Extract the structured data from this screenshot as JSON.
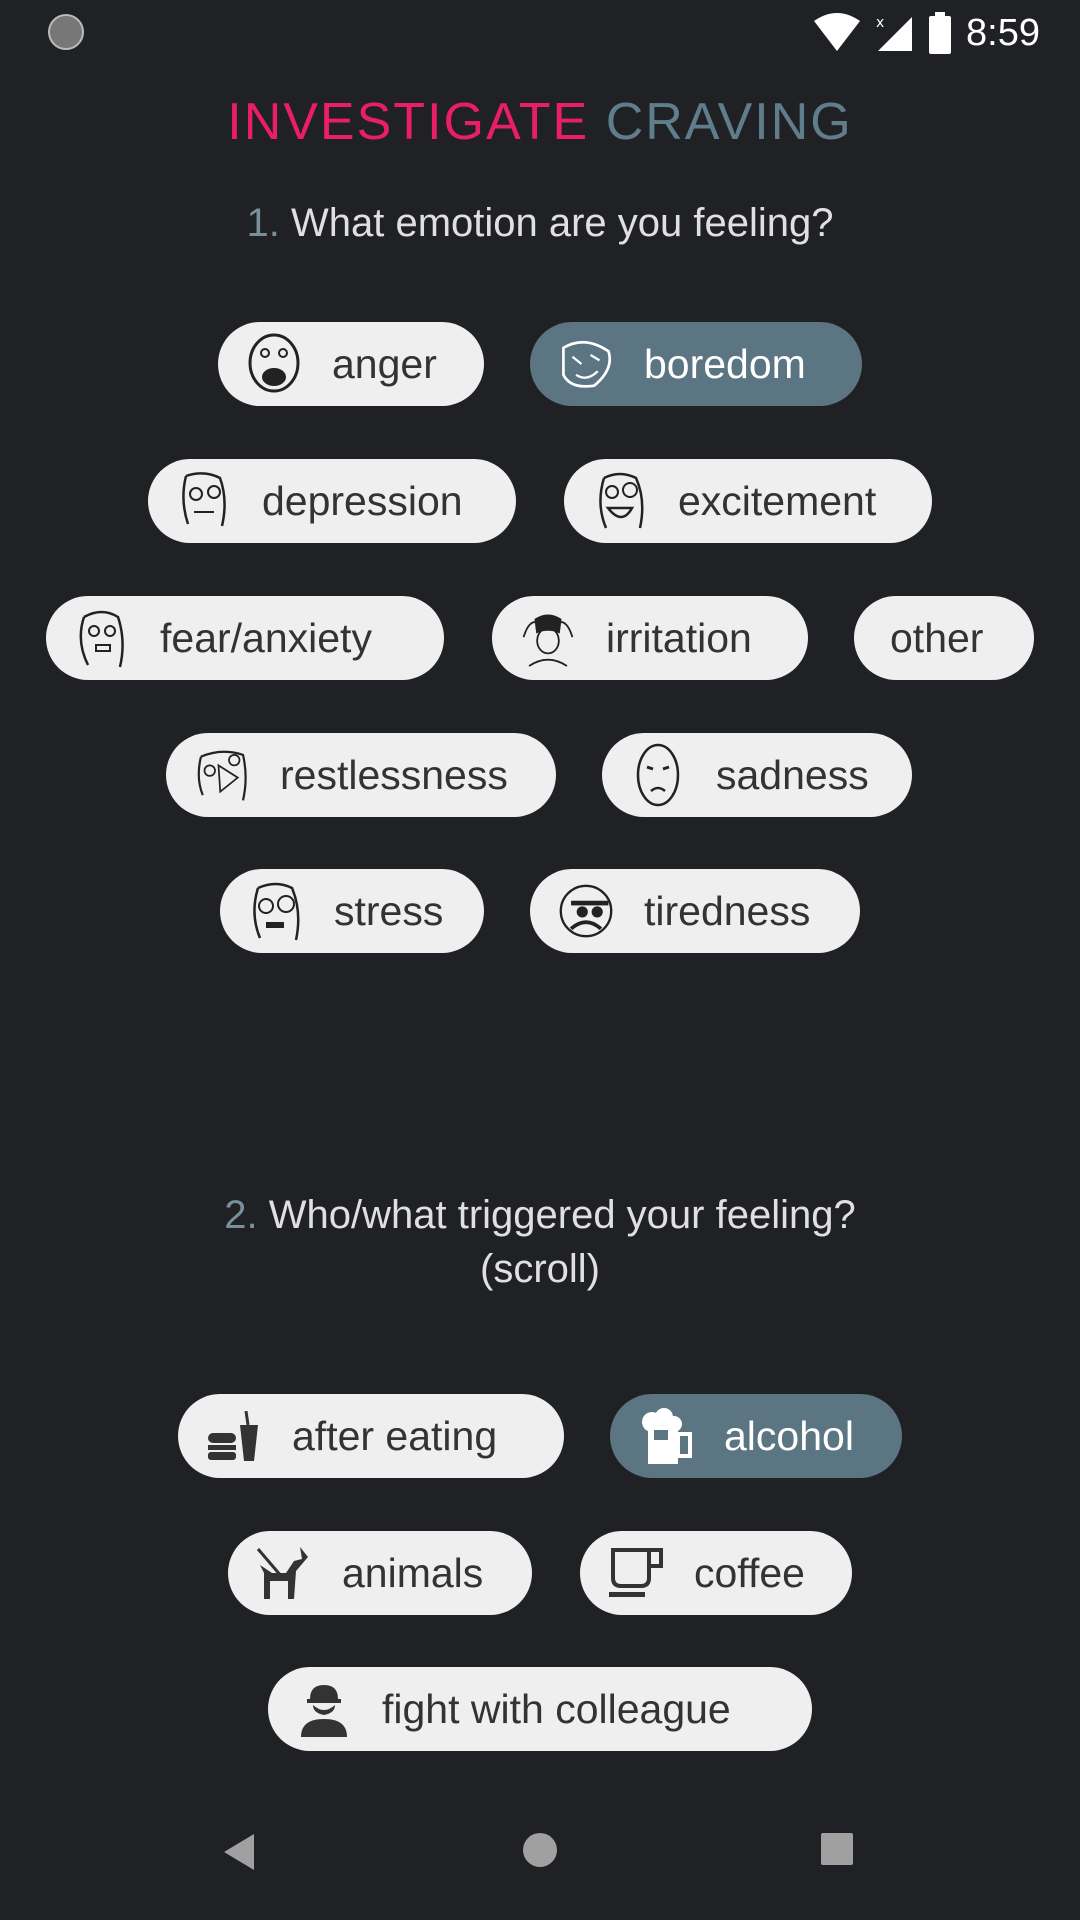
{
  "status_bar": {
    "time": "8:59",
    "icons": [
      "sync-icon",
      "wifi-icon",
      "no-signal-icon",
      "battery-icon"
    ]
  },
  "title": {
    "part1": "INVESTIGATE",
    "part2": "CRAVING",
    "part1_color": "#e91e63",
    "part2_color": "#607d8b"
  },
  "question1": {
    "number": "1.",
    "text": "What emotion are you feeling?"
  },
  "emotions": [
    {
      "label": "anger",
      "icon": "rage-face-icon",
      "selected": false
    },
    {
      "label": "boredom",
      "icon": "troll-face-icon",
      "selected": true
    },
    {
      "label": "depression",
      "icon": "meh-face-icon",
      "selected": false
    },
    {
      "label": "excitement",
      "icon": "excited-face-icon",
      "selected": false
    },
    {
      "label": "fear/anxiety",
      "icon": "scared-face-icon",
      "selected": false
    },
    {
      "label": "irritation",
      "icon": "frustrated-face-icon",
      "selected": false
    },
    {
      "label": "other",
      "icon": null,
      "selected": false
    },
    {
      "label": "restlessness",
      "icon": "fuu-face-icon",
      "selected": false
    },
    {
      "label": "sadness",
      "icon": "okay-face-icon",
      "selected": false
    },
    {
      "label": "stress",
      "icon": "stressed-face-icon",
      "selected": false
    },
    {
      "label": "tiredness",
      "icon": "me-gusta-face-icon",
      "selected": false
    }
  ],
  "question2": {
    "number": "2.",
    "text": "Who/what triggered your feeling?",
    "hint": "(scroll)"
  },
  "triggers": [
    {
      "label": "after eating",
      "icon": "fastfood-icon",
      "selected": false
    },
    {
      "label": "alcohol",
      "icon": "beer-mug-icon",
      "selected": true
    },
    {
      "label": "animals",
      "icon": "dog-walk-icon",
      "selected": false
    },
    {
      "label": "coffee",
      "icon": "coffee-cup-icon",
      "selected": false
    },
    {
      "label": "fight with colleague",
      "icon": "worker-icon",
      "selected": false
    }
  ],
  "colors": {
    "background": "#202125",
    "chip": "#efefef",
    "chip_selected": "#5b7582"
  }
}
